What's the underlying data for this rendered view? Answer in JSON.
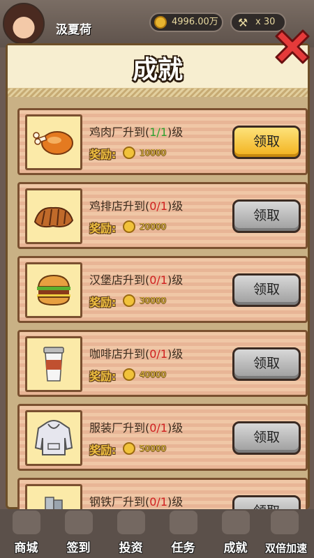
{
  "topbar": {
    "player_name": "汲夏荷",
    "coins": "4996.00万",
    "boost": "x 30"
  },
  "panel": {
    "title": "成就",
    "reward_label": "奖励:",
    "achievements": [
      {
        "name": "鸡肉厂升到(",
        "progress": "1/1",
        "suffix": ")级",
        "reward": "10000",
        "claim": "领取",
        "icon": "chicken-drumstick-icon",
        "claimable": true
      },
      {
        "name": "鸡排店升到(",
        "progress": "0/1",
        "suffix": ")级",
        "reward": "20000",
        "claim": "领取",
        "icon": "chicken-cutlet-icon",
        "claimable": false
      },
      {
        "name": "汉堡店升到(",
        "progress": "0/1",
        "suffix": ")级",
        "reward": "30000",
        "claim": "领取",
        "icon": "hamburger-icon",
        "claimable": false
      },
      {
        "name": "咖啡店升到(",
        "progress": "0/1",
        "suffix": ")级",
        "reward": "40000",
        "claim": "领取",
        "icon": "coffee-cup-icon",
        "claimable": false
      },
      {
        "name": "服装厂升到(",
        "progress": "0/1",
        "suffix": ")级",
        "reward": "50000",
        "claim": "领取",
        "icon": "hoodie-icon",
        "claimable": false
      },
      {
        "name": "钢铁厂升到(",
        "progress": "0/1",
        "suffix": ")级",
        "reward": "",
        "claim": "领取",
        "icon": "steel-roll-icon",
        "claimable": false
      }
    ]
  },
  "bottomnav": {
    "items": [
      "商城",
      "签到",
      "投资",
      "任务",
      "成就",
      "双倍加速"
    ]
  },
  "colors": {
    "claim_active": "#f2b11c",
    "claim_disabled": "#9d9d9d",
    "progress_done": "#2ea02e",
    "progress_todo": "#d02020"
  }
}
